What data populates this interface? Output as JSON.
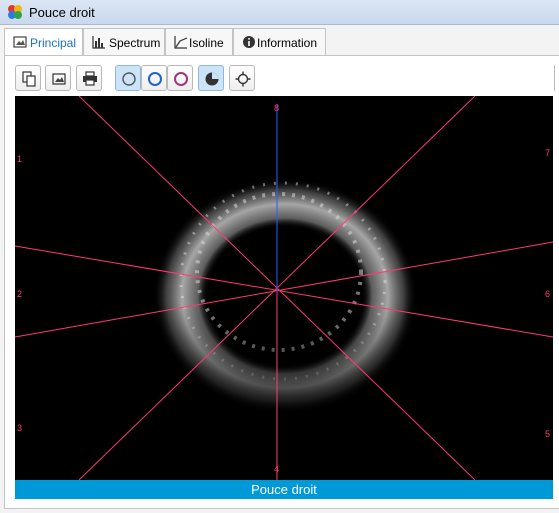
{
  "window": {
    "title": "Pouce droit"
  },
  "tabs": [
    {
      "label": "Principal",
      "icon": "image-icon",
      "active": true
    },
    {
      "label": "Spectrum",
      "icon": "histogram-icon",
      "active": false
    },
    {
      "label": "Isoline",
      "icon": "line-chart-icon",
      "active": false
    },
    {
      "label": "Information",
      "icon": "info-icon",
      "active": false
    }
  ],
  "toolbar": {
    "buttons": [
      {
        "name": "copy-button",
        "icon": "copy-icon"
      },
      {
        "name": "save-image-button",
        "icon": "image-icon"
      },
      {
        "name": "print-button",
        "icon": "printer-icon"
      },
      {
        "name": "circle-gray-button",
        "icon": "circle-gray-icon",
        "active": true
      },
      {
        "name": "circle-blue-button",
        "icon": "circle-blue-icon"
      },
      {
        "name": "circle-purple-button",
        "icon": "circle-purple-icon"
      },
      {
        "name": "sector-button",
        "icon": "pie-sector-icon",
        "active": true
      },
      {
        "name": "center-button",
        "icon": "crosshair-icon"
      }
    ]
  },
  "viewer": {
    "sector_labels": [
      "8",
      "7",
      "6",
      "5",
      "4",
      "3",
      "2",
      "1"
    ],
    "colors": {
      "sector_line": "#ff3a6e",
      "axis_line": "#2f5bff",
      "background": "#000000"
    }
  },
  "status": {
    "label": "Pouce droit"
  }
}
